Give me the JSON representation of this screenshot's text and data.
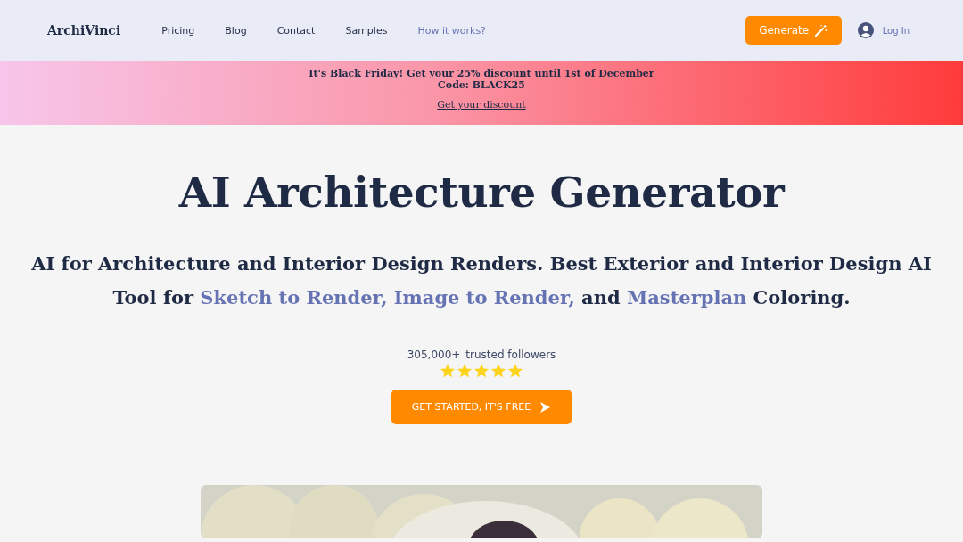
{
  "nav": {
    "logo": "ArchiVinci",
    "links": [
      {
        "label": "Pricing",
        "kind": "plain"
      },
      {
        "label": "Blog",
        "kind": "plain"
      },
      {
        "label": "Contact",
        "kind": "plain"
      },
      {
        "label": "Samples",
        "kind": "plain"
      },
      {
        "label": "How it works?",
        "kind": "accent"
      }
    ],
    "generate_button": "Generate",
    "login": "Log In"
  },
  "banner": {
    "lines": [
      "It's Black Friday! Get your 25% discount until 1st of December",
      "Code: BLACK25"
    ],
    "link": "Get your discount"
  },
  "hero": {
    "title": "AI Architecture Generator",
    "subtitle": [
      {
        "text": "AI for Architecture and Interior Design Renders. Best Exterior and Interior Design AI Tool for ",
        "highlight": false
      },
      {
        "text": "Sketch to Render, Image to Render,",
        "highlight": true
      },
      {
        "text": " and ",
        "highlight": false
      },
      {
        "text": "Masterplan",
        "highlight": true
      },
      {
        "text": " Coloring.",
        "highlight": false
      }
    ],
    "followers_count": "305,000+",
    "followers_label": "trusted followers",
    "stars": 5,
    "cta": "GET STARTED, IT'S FREE"
  }
}
